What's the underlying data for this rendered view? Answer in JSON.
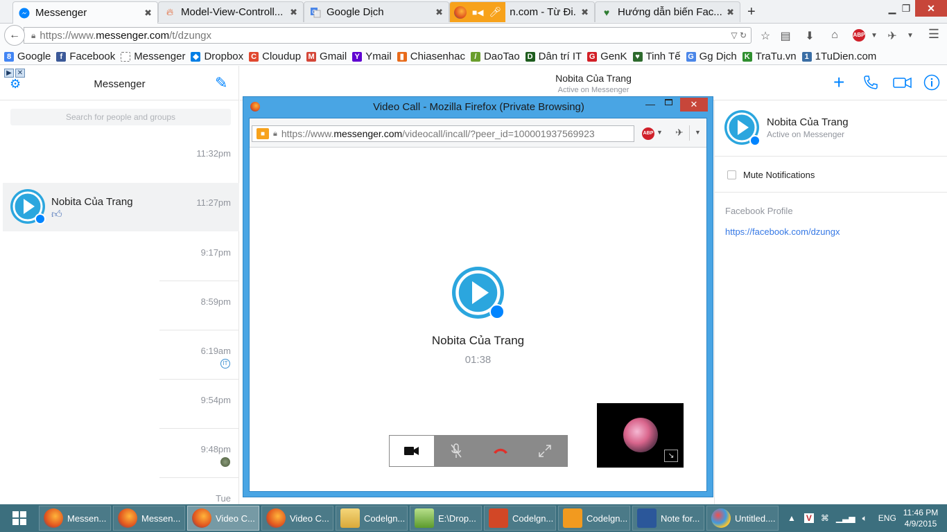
{
  "browser": {
    "tabs": [
      {
        "title": "Messenger"
      },
      {
        "title": "Model-View-Controll..."
      },
      {
        "title": "Google Dịch"
      },
      {
        "title": "n.com - Từ Đi..."
      },
      {
        "title": "Hướng dẫn biến Fac..."
      }
    ],
    "url": {
      "scheme": "https://www.",
      "domain": "messenger.com",
      "path": "/t/dzungx"
    },
    "bookmarks": [
      {
        "label": "Google",
        "color": "#4285f4",
        "glyph": "8"
      },
      {
        "label": "Facebook",
        "color": "#3b5998",
        "glyph": "f"
      },
      {
        "label": "Messenger",
        "color": "#ffffff",
        "glyph": ""
      },
      {
        "label": "Dropbox",
        "color": "#007ee5",
        "glyph": "◆"
      },
      {
        "label": "Cloudup",
        "color": "#e0482f",
        "glyph": "C"
      },
      {
        "label": "Gmail",
        "color": "#d44638",
        "glyph": "M"
      },
      {
        "label": "Ymail",
        "color": "#5f01d1",
        "glyph": "Y"
      },
      {
        "label": "Chiasenhac",
        "color": "#e86a1a",
        "glyph": "▮"
      },
      {
        "label": "DaoTao",
        "color": "#6a9e2d",
        "glyph": "/"
      },
      {
        "label": "Dân trí IT",
        "color": "#1d5c1d",
        "glyph": "D"
      },
      {
        "label": "GenK",
        "color": "#d21f26",
        "glyph": "G"
      },
      {
        "label": "Tinh Tế",
        "color": "#2d6a2d",
        "glyph": "♥"
      },
      {
        "label": "Gg Dịch",
        "color": "#4a86e8",
        "glyph": "G"
      },
      {
        "label": "TraTu.vn",
        "color": "#2f8f2f",
        "glyph": "K"
      },
      {
        "label": "1TuDien.com",
        "color": "#3a6ea5",
        "glyph": "1"
      }
    ]
  },
  "messenger": {
    "title": "Messenger",
    "search_placeholder": "Search for people and groups",
    "conversations": [
      {
        "name": "",
        "time": "11:32pm"
      },
      {
        "name": "Nobita Của Trang",
        "time": "11:27pm",
        "selected": true
      },
      {
        "name": "",
        "time": "9:17pm"
      },
      {
        "name": "",
        "time": "8:59pm"
      },
      {
        "name": "",
        "time": "6:19am"
      },
      {
        "name": "",
        "time": "9:54pm"
      },
      {
        "name": "",
        "time": "9:48pm"
      },
      {
        "name": "",
        "time": "Tue"
      }
    ],
    "header": {
      "name": "Nobita Của Trang",
      "status": "Active on Messenger"
    },
    "info": {
      "name": "Nobita Của Trang",
      "status": "Active on Messenger",
      "mute_label": "Mute Notifications",
      "profile_label": "Facebook Profile",
      "profile_url": "https://facebook.com/dzungx"
    }
  },
  "popup": {
    "title": "Video Call - Mozilla Firefox (Private Browsing)",
    "url_scheme": "https://www.",
    "url_domain": "messenger.com",
    "url_path": "/videocall/incall/?peer_id=100001937569923",
    "caller_name": "Nobita Của Trang",
    "call_timer": "01:38"
  },
  "taskbar": {
    "items": [
      {
        "label": "Messen...",
        "icon": "firefox"
      },
      {
        "label": "Messen...",
        "icon": "firefox"
      },
      {
        "label": "Video C...",
        "icon": "firefox",
        "active": true
      },
      {
        "label": "Video C...",
        "icon": "firefox"
      },
      {
        "label": "Codelgn...",
        "icon": "folder"
      },
      {
        "label": "E:\\Drop...",
        "icon": "notepad"
      },
      {
        "label": "Codelgn...",
        "icon": "powerpoint"
      },
      {
        "label": "Codelgn...",
        "icon": "pdf"
      },
      {
        "label": "Note for...",
        "icon": "word"
      },
      {
        "label": "Untitled....",
        "icon": "paint"
      }
    ],
    "language": "ENG",
    "time": "11:46 PM",
    "date": "4/9/2015"
  }
}
